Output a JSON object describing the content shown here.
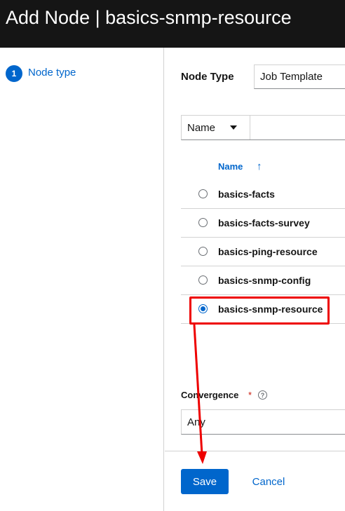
{
  "header": {
    "title": "Add Node | basics-snmp-resource"
  },
  "wizard_nav": {
    "steps": [
      {
        "number": "1",
        "label": "Node type"
      }
    ]
  },
  "node_type": {
    "label": "Node Type",
    "value": "Job Template"
  },
  "filter": {
    "field": "Name"
  },
  "table": {
    "column_name": "Name",
    "rows": [
      {
        "name": "basics-facts",
        "selected": false
      },
      {
        "name": "basics-facts-survey",
        "selected": false
      },
      {
        "name": "basics-ping-resource",
        "selected": false
      },
      {
        "name": "basics-snmp-config",
        "selected": false
      },
      {
        "name": "basics-snmp-resource",
        "selected": true
      }
    ]
  },
  "convergence": {
    "label": "Convergence",
    "required_mark": "*",
    "value": "Any"
  },
  "footer": {
    "save_label": "Save",
    "cancel_label": "Cancel"
  },
  "annotation": {
    "color": "#ee0000"
  },
  "colors": {
    "accent": "#0066cc",
    "header_bg": "#151515"
  }
}
